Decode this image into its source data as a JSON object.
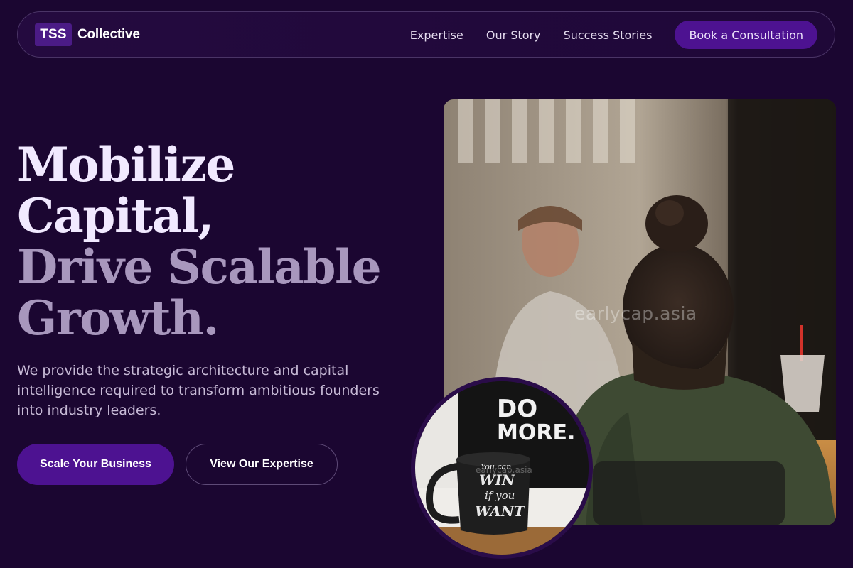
{
  "nav": {
    "brand_mark": "TSS",
    "brand_name": "Collective",
    "links": [
      "Expertise",
      "Our Story",
      "Success Stories"
    ],
    "cta": "Book a Consultation"
  },
  "hero": {
    "headline_line1": "Mobilize",
    "headline_line2": "Capital,",
    "headline_line3": "Drive Scalable",
    "headline_line4": "Growth.",
    "subtext": "We provide the strategic architecture and capital intelligence required to transform ambitious founders into industry leaders.",
    "primary_cta": "Scale Your Business",
    "secondary_cta": "View Our Expertise"
  },
  "media": {
    "main_photo_watermark": "earlycap.asia",
    "inset_photo_watermark": "earlycap.asia",
    "inset_sign_line1": "DO",
    "inset_sign_line2": "MORE.",
    "mug_line1": "You can",
    "mug_line2": "WIN",
    "mug_line3": "if you",
    "mug_line4": "WANT"
  },
  "colors": {
    "background": "#1b0631",
    "accent": "#4d1291",
    "headline_primary": "#f1e9ff",
    "headline_secondary": "#a897bd"
  }
}
